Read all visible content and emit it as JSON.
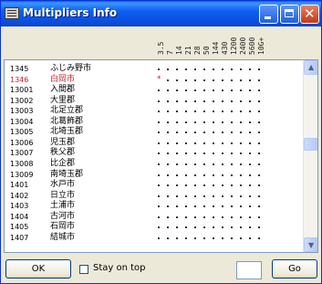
{
  "window": {
    "title": "Multipliers Info",
    "controls": {
      "minimize": "minimize-icon",
      "maximize": "maximize-icon",
      "close": "close-icon",
      "close_glyph": "✕"
    }
  },
  "bands": [
    "3.5",
    "7",
    "14",
    "21",
    "28",
    "50",
    "144",
    "430",
    "1200",
    "2400",
    "5600",
    "10G+"
  ],
  "rows": [
    {
      "code": "1345",
      "name": "ふじみ野市",
      "highlight": false,
      "mark_col": null
    },
    {
      "code": "1346",
      "name": "白岡市",
      "highlight": true,
      "mark_col": 0
    },
    {
      "code": "13001",
      "name": "入間郡",
      "highlight": false,
      "mark_col": null
    },
    {
      "code": "13002",
      "name": "大里郡",
      "highlight": false,
      "mark_col": null
    },
    {
      "code": "13003",
      "name": "北足立郡",
      "highlight": false,
      "mark_col": null
    },
    {
      "code": "13004",
      "name": "北葛飾郡",
      "highlight": false,
      "mark_col": null
    },
    {
      "code": "13005",
      "name": "北埼玉郡",
      "highlight": false,
      "mark_col": null
    },
    {
      "code": "13006",
      "name": "児玉郡",
      "highlight": false,
      "mark_col": null
    },
    {
      "code": "13007",
      "name": "秩父郡",
      "highlight": false,
      "mark_col": null
    },
    {
      "code": "13008",
      "name": "比企郡",
      "highlight": false,
      "mark_col": null
    },
    {
      "code": "13009",
      "name": "南埼玉郡",
      "highlight": false,
      "mark_col": null
    },
    {
      "code": "1401",
      "name": "水戸市",
      "highlight": false,
      "mark_col": null
    },
    {
      "code": "1402",
      "name": "日立市",
      "highlight": false,
      "mark_col": null
    },
    {
      "code": "1403",
      "name": "土浦市",
      "highlight": false,
      "mark_col": null
    },
    {
      "code": "1404",
      "name": "古河市",
      "highlight": false,
      "mark_col": null
    },
    {
      "code": "1405",
      "name": "石岡市",
      "highlight": false,
      "mark_col": null
    },
    {
      "code": "1407",
      "name": "結城市",
      "highlight": false,
      "mark_col": null
    }
  ],
  "mark_glyph": "*",
  "scroll": {
    "up_arrow": "▲",
    "down_arrow": "▼",
    "position": 0.42
  },
  "footer": {
    "ok_label": "OK",
    "stay_on_top_label": "Stay on top",
    "stay_on_top_checked": false,
    "input_value": "",
    "go_label": "Go"
  },
  "colors": {
    "highlight": "#d0202a",
    "titlebar": "#0a5ee8"
  }
}
